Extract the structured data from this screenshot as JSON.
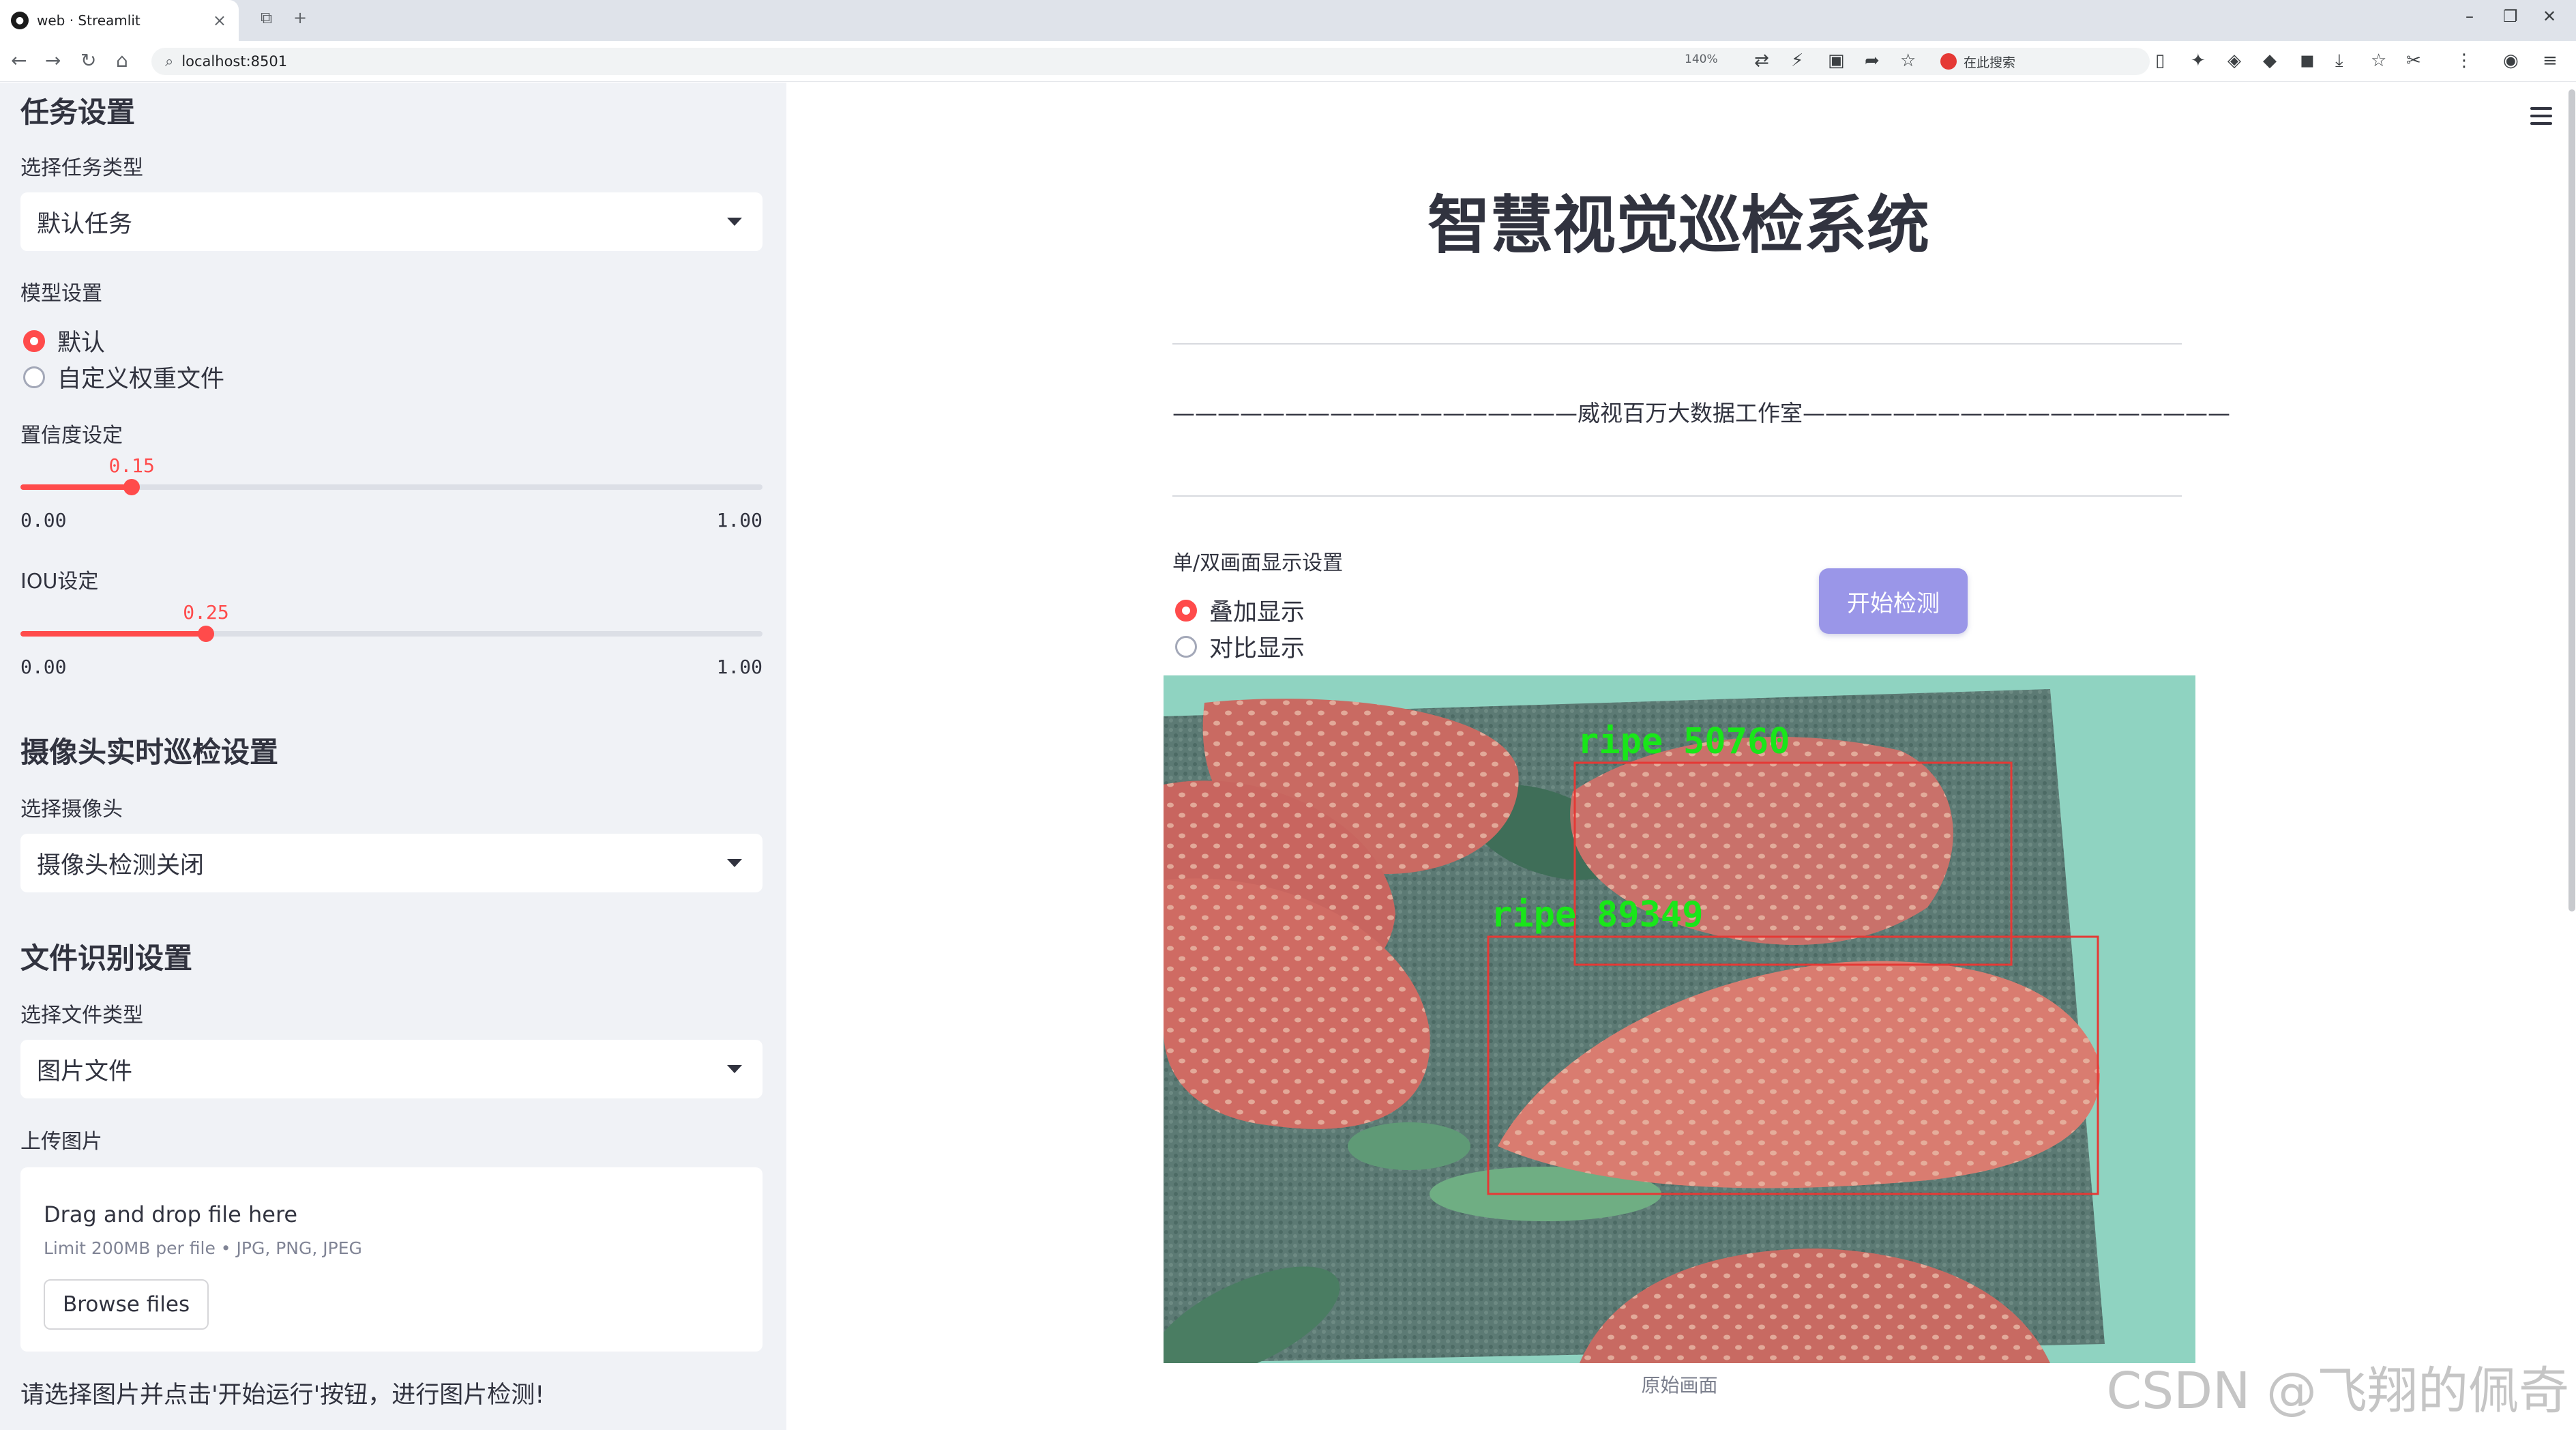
{
  "browser": {
    "tab_title": "web · Streamlit",
    "tab_favicon": "streamlit-icon",
    "url": "localhost:8501",
    "zoom": "140%",
    "search_placeholder": "在此搜索"
  },
  "sidebar": {
    "task_section_title": "任务设置",
    "task_type_label": "选择任务类型",
    "task_type_value": "默认任务",
    "model_label": "模型设置",
    "model_options": [
      "默认",
      "自定义权重文件"
    ],
    "model_selected": 0,
    "confidence": {
      "label": "置信度设定",
      "value": "0.15",
      "value_num": 0.15,
      "min": "0.00",
      "max": "1.00"
    },
    "iou": {
      "label": "IOU设定",
      "value": "0.25",
      "value_num": 0.25,
      "min": "0.00",
      "max": "1.00"
    },
    "camera_section_title": "摄像头实时巡检设置",
    "camera_label": "选择摄像头",
    "camera_value": "摄像头检测关闭",
    "file_section_title": "文件识别设置",
    "file_type_label": "选择文件类型",
    "file_type_value": "图片文件",
    "upload_label": "上传图片",
    "upload": {
      "drag_text": "Drag and drop file here",
      "limit_text": "Limit 200MB per file • JPG, PNG, JPEG",
      "browse_label": "Browse files"
    },
    "hint": "请选择图片并点击'开始运行'按钮，进行图片检测!"
  },
  "main": {
    "title": "智慧视觉巡检系统",
    "subtitle": "——————————————————威视百万大数据工作室———————————————————",
    "display_mode_label": "单/双画面显示设置",
    "display_options": [
      "叠加显示",
      "对比显示"
    ],
    "display_selected": 0,
    "start_button": "开始检测",
    "image_caption": "原始画面",
    "detections": [
      {
        "label": "ripe",
        "score": "50760"
      },
      {
        "label": "ripe",
        "score": "89349"
      }
    ],
    "detection_color": "#e53935",
    "detection_text_color": "#19e619",
    "watermark": "CSDN @飞翔的佩奇"
  },
  "colors": {
    "accent": "#ff4b4b",
    "sidebar_bg": "#f0f2f6",
    "button_bg": "#9a96e8"
  }
}
